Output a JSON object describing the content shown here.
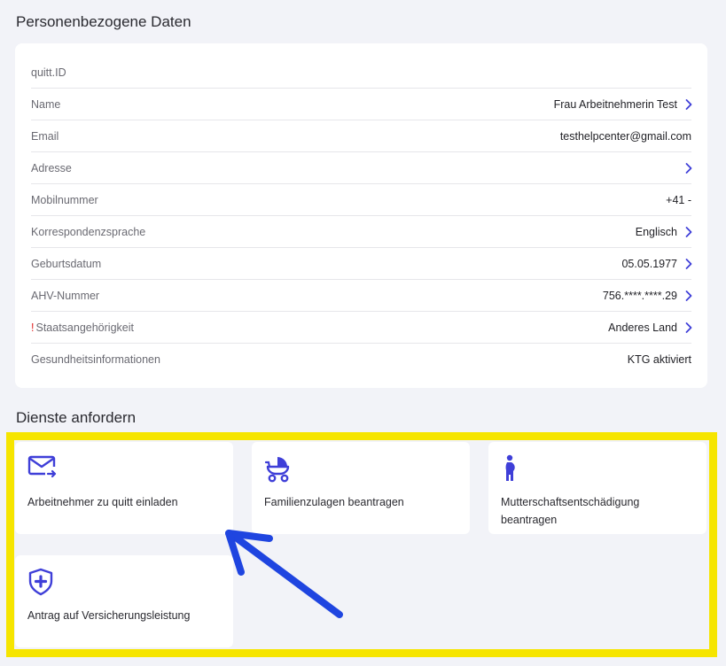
{
  "sections": {
    "personal_title": "Personenbezogene Daten",
    "services_title": "Dienste anfordern"
  },
  "personal": {
    "rows": [
      {
        "label": "quitt.ID",
        "value": "",
        "chevron": false
      },
      {
        "label": "Name",
        "value": "Frau Arbeitnehmerin Test",
        "chevron": true
      },
      {
        "label": "Email",
        "value": "testhelpcenter@gmail.com",
        "chevron": false
      },
      {
        "label": "Adresse",
        "value": "",
        "chevron": true
      },
      {
        "label": "Mobilnummer",
        "value": "+41 -",
        "chevron": false
      },
      {
        "label": "Korrespondenzsprache",
        "value": "Englisch",
        "chevron": true
      },
      {
        "label": "Geburtsdatum",
        "value": "05.05.1977",
        "chevron": true
      },
      {
        "label": "AHV-Nummer",
        "value": "756.****.****.29",
        "chevron": true
      },
      {
        "label": "Staatsangehörigkeit",
        "value": "Anderes Land",
        "chevron": true,
        "warning": "!"
      },
      {
        "label": "Gesundheitsinformationen",
        "value": "KTG aktiviert",
        "chevron": false
      }
    ]
  },
  "services": {
    "invite": {
      "label": "Arbeitnehmer zu quitt einladen",
      "icon": "mail-send-icon"
    },
    "family": {
      "label": "Familienzulagen beantragen",
      "icon": "stroller-icon"
    },
    "maternity": {
      "label": "Mutterschaftsentschädigung beantragen",
      "icon": "pregnant-woman-icon"
    },
    "insurance": {
      "label": "Antrag auf Versicherungsleistung",
      "icon": "shield-plus-icon"
    }
  },
  "colors": {
    "accent": "#3f3fd8",
    "highlight": "#f6e500",
    "annotation_arrow": "#1f45e0",
    "warning": "#e02424"
  }
}
